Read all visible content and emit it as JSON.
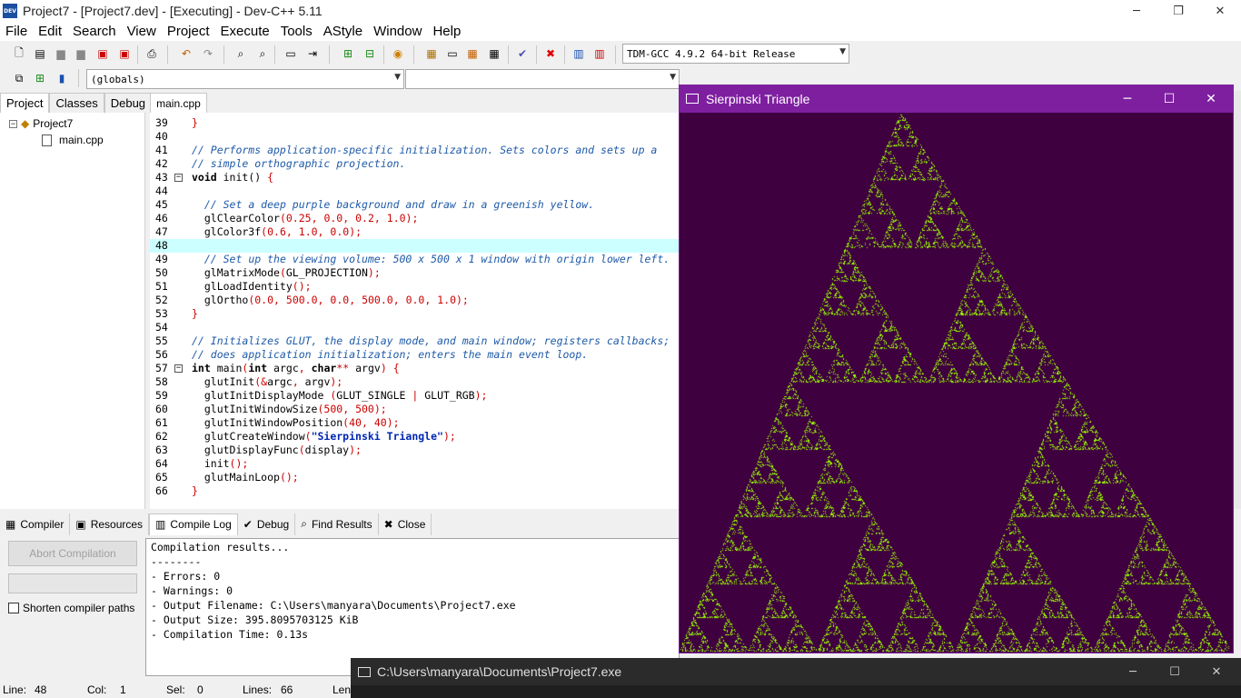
{
  "window": {
    "title": "Project7 - [Project7.dev] - [Executing] - Dev-C++ 5.11",
    "app_icon": "dev-icon"
  },
  "menu": [
    "File",
    "Edit",
    "Search",
    "View",
    "Project",
    "Execute",
    "Tools",
    "AStyle",
    "Window",
    "Help"
  ],
  "toolbar": {
    "compiler_select": "TDM-GCC 4.9.2 64-bit Release",
    "scope_select": "(globals)"
  },
  "left_tabs": [
    "Project",
    "Classes",
    "Debug"
  ],
  "project_tree": {
    "project": "Project7",
    "file": "main.cpp"
  },
  "editor": {
    "tab": "main.cpp",
    "highlight_line": 48,
    "lines": [
      {
        "n": "39",
        "fold": false,
        "html": "<span class='c-sym'>}</span>"
      },
      {
        "n": "40",
        "fold": false,
        "html": ""
      },
      {
        "n": "41",
        "fold": false,
        "html": "<span class='c-cmt'>// Performs application-specific initialization. Sets colors and sets up a</span>"
      },
      {
        "n": "42",
        "fold": false,
        "html": "<span class='c-cmt'>// simple orthographic projection.</span>"
      },
      {
        "n": "43",
        "fold": true,
        "html": "<span class='c-kw'>void</span> init() <span class='c-sym'>{</span>"
      },
      {
        "n": "44",
        "fold": false,
        "html": ""
      },
      {
        "n": "45",
        "fold": false,
        "html": "  <span class='c-cmt'>// Set a deep purple background and draw in a greenish yellow.</span>"
      },
      {
        "n": "46",
        "fold": false,
        "html": "  glClearColor<span class='c-sym'>(</span><span class='c-num'>0.25</span><span class='c-sym'>,</span> <span class='c-num'>0.0</span><span class='c-sym'>,</span> <span class='c-num'>0.2</span><span class='c-sym'>,</span> <span class='c-num'>1.0</span><span class='c-sym'>);</span>"
      },
      {
        "n": "47",
        "fold": false,
        "html": "  glColor3f<span class='c-sym'>(</span><span class='c-num'>0.6</span><span class='c-sym'>,</span> <span class='c-num'>1.0</span><span class='c-sym'>,</span> <span class='c-num'>0.0</span><span class='c-sym'>);</span>"
      },
      {
        "n": "48",
        "fold": false,
        "html": ""
      },
      {
        "n": "49",
        "fold": false,
        "html": "  <span class='c-cmt'>// Set up the viewing volume: 500 x 500 x 1 window with origin lower left.</span>"
      },
      {
        "n": "50",
        "fold": false,
        "html": "  glMatrixMode<span class='c-sym'>(</span>GL_PROJECTION<span class='c-sym'>);</span>"
      },
      {
        "n": "51",
        "fold": false,
        "html": "  glLoadIdentity<span class='c-sym'>();</span>"
      },
      {
        "n": "52",
        "fold": false,
        "html": "  glOrtho<span class='c-sym'>(</span><span class='c-num'>0.0</span><span class='c-sym'>,</span> <span class='c-num'>500.0</span><span class='c-sym'>,</span> <span class='c-num'>0.0</span><span class='c-sym'>,</span> <span class='c-num'>500.0</span><span class='c-sym'>,</span> <span class='c-num'>0.0</span><span class='c-sym'>,</span> <span class='c-num'>1.0</span><span class='c-sym'>);</span>"
      },
      {
        "n": "53",
        "fold": false,
        "html": "<span class='c-sym'>}</span>"
      },
      {
        "n": "54",
        "fold": false,
        "html": ""
      },
      {
        "n": "55",
        "fold": false,
        "html": "<span class='c-cmt'>// Initializes GLUT, the display mode, and main window; registers callbacks;</span>"
      },
      {
        "n": "56",
        "fold": false,
        "html": "<span class='c-cmt'>// does application initialization; enters the main event loop.</span>"
      },
      {
        "n": "57",
        "fold": true,
        "html": "<span class='c-kw'>int</span> main<span class='c-sym'>(</span><span class='c-kw'>int</span> argc<span class='c-sym'>,</span> <span class='c-kw'>char</span><span class='c-sym'>**</span> argv<span class='c-sym'>)</span> <span class='c-sym'>{</span>"
      },
      {
        "n": "58",
        "fold": false,
        "html": "  glutInit<span class='c-sym'>(&amp;</span>argc<span class='c-sym'>,</span> argv<span class='c-sym'>);</span>"
      },
      {
        "n": "59",
        "fold": false,
        "html": "  glutInitDisplayMode <span class='c-sym'>(</span>GLUT_SINGLE <span class='c-sym'>|</span> GLUT_RGB<span class='c-sym'>);</span>"
      },
      {
        "n": "60",
        "fold": false,
        "html": "  glutInitWindowSize<span class='c-sym'>(</span><span class='c-num'>500</span><span class='c-sym'>,</span> <span class='c-num'>500</span><span class='c-sym'>);</span>"
      },
      {
        "n": "61",
        "fold": false,
        "html": "  glutInitWindowPosition<span class='c-sym'>(</span><span class='c-num'>40</span><span class='c-sym'>,</span> <span class='c-num'>40</span><span class='c-sym'>);</span>"
      },
      {
        "n": "62",
        "fold": false,
        "html": "  glutCreateWindow<span class='c-sym'>(</span><span class='c-str'>\"Sierpinski Triangle\"</span><span class='c-sym'>);</span>"
      },
      {
        "n": "63",
        "fold": false,
        "html": "  glutDisplayFunc<span class='c-sym'>(</span>display<span class='c-sym'>);</span>"
      },
      {
        "n": "64",
        "fold": false,
        "html": "  init<span class='c-sym'>();</span>"
      },
      {
        "n": "65",
        "fold": false,
        "html": "  glutMainLoop<span class='c-sym'>();</span>"
      },
      {
        "n": "66",
        "fold": false,
        "html": "<span class='c-sym'>}</span>"
      }
    ]
  },
  "bottom_tabs": [
    {
      "label": "Compiler",
      "icon": "grid-icon",
      "glyph": "▦"
    },
    {
      "label": "Resources",
      "icon": "resources-icon",
      "glyph": "▣"
    },
    {
      "label": "Compile Log",
      "icon": "bar-chart-icon",
      "glyph": "▥"
    },
    {
      "label": "Debug",
      "icon": "check-icon",
      "glyph": "✔"
    },
    {
      "label": "Find Results",
      "icon": "find-icon",
      "glyph": "⌕"
    },
    {
      "label": "Close",
      "icon": "close-tab-icon",
      "glyph": "✖"
    }
  ],
  "compile": {
    "abort_label": "Abort Compilation",
    "shorten_label": "Shorten compiler paths",
    "log": [
      "Compilation results...",
      "--------",
      "- Errors: 0",
      "- Warnings: 0",
      "- Output Filename: C:\\Users\\manyara\\Documents\\Project7.exe",
      "- Output Size: 395.8095703125 KiB",
      "- Compilation Time: 0.13s"
    ]
  },
  "status": {
    "line_label": "Line:",
    "line": "48",
    "col_label": "Col:",
    "col": "1",
    "sel_label": "Sel:",
    "sel": "0",
    "lines_label": "Lines:",
    "lines": "66",
    "len_label": "Len"
  },
  "glut_window": {
    "title": "Sierpinski Triangle",
    "bg_color": "#3f003f",
    "fg_color": "#99ff00",
    "title_color": "#7e1fa0"
  },
  "console_window": {
    "title": "C:\\Users\\manyara\\Documents\\Project7.exe"
  }
}
